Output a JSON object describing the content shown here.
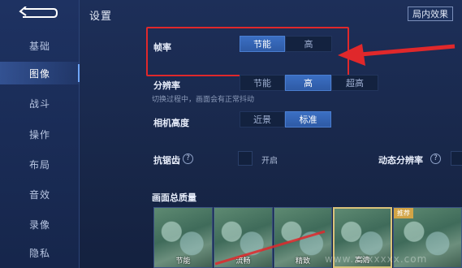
{
  "header": {
    "title": "设置",
    "effect_button": "局内效果"
  },
  "sidebar": {
    "items": [
      {
        "label": "基础",
        "active": false
      },
      {
        "label": "图像",
        "active": true
      },
      {
        "label": "战斗",
        "active": false
      },
      {
        "label": "操作",
        "active": false
      },
      {
        "label": "布局",
        "active": false
      },
      {
        "label": "音效",
        "active": false
      },
      {
        "label": "录像",
        "active": false
      },
      {
        "label": "隐私",
        "active": false
      }
    ]
  },
  "settings": {
    "frame_rate": {
      "label": "帧率",
      "options": [
        "节能",
        "高"
      ],
      "selected": "节能"
    },
    "resolution": {
      "label": "分辨率",
      "options": [
        "节能",
        "高",
        "超高"
      ],
      "selected": "高",
      "hint": "切换过程中，画面会有正常抖动"
    },
    "camera_height": {
      "label": "相机高度",
      "options": [
        "近景",
        "标准"
      ],
      "selected": "标准"
    },
    "anti_aliasing": {
      "label": "抗锯齿",
      "toggle_label": "开启",
      "checked": false
    },
    "dynamic_resolution": {
      "label": "动态分辨率"
    },
    "overall_quality": {
      "label": "画面总质量",
      "thumbnails": [
        {
          "label": "节能",
          "selected": false,
          "recommended": false
        },
        {
          "label": "流畅",
          "selected": false,
          "recommended": false
        },
        {
          "label": "精致",
          "selected": false,
          "recommended": false
        },
        {
          "label": "高清",
          "selected": true,
          "recommended": false
        },
        {
          "label": "",
          "selected": false,
          "recommended": true,
          "badge": "推荐"
        }
      ]
    }
  },
  "annotation": {
    "color": "#e0282b"
  },
  "watermark": "www.xxxxxxx.com",
  "colors": {
    "accent": "#2e5aa5",
    "background": "#1a2a4e",
    "highlight": "#e0282b"
  }
}
